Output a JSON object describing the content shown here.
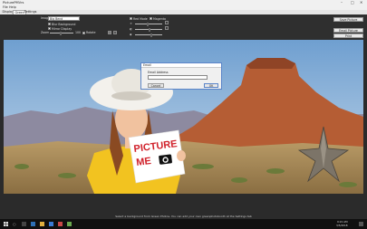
{
  "window": {
    "title": "PicturePMVrs"
  },
  "menu": {
    "items": [
      "File",
      "Help"
    ]
  },
  "tabs": [
    "Display",
    "Green",
    "Settings"
  ],
  "controls": {
    "image_label": "Image:",
    "image_value": "Big Bend",
    "blur_background": "Blur Background",
    "mirror_display": "Mirror Display",
    "zoom_label": "Zoom",
    "zoom_value": "100",
    "rotate_label": "Rotate",
    "red_channel_label": "Red Mode",
    "magenta_label": "Magenta",
    "save_picture": "Save Picture",
    "email_picture": "Email Picture",
    "print": "Print"
  },
  "sign": {
    "line1": "PICTURE",
    "line2": "ME"
  },
  "dialog": {
    "title": "Email",
    "field_label": "Email Address",
    "email_value": "",
    "cancel_label": "Cancel",
    "ok_label": "OK"
  },
  "status": {
    "text": "Select a background from Green Photos. You can add your own greenphotobooth at the Settings tab"
  },
  "taskbar": {
    "time": "9:21 AM",
    "date": "3/5/2018"
  },
  "colors": {
    "accent": "#5a84c8",
    "sign_red": "#d0202a",
    "sky": "#8fb6dc",
    "rock": "#b55d34",
    "desert": "#b89a66"
  }
}
